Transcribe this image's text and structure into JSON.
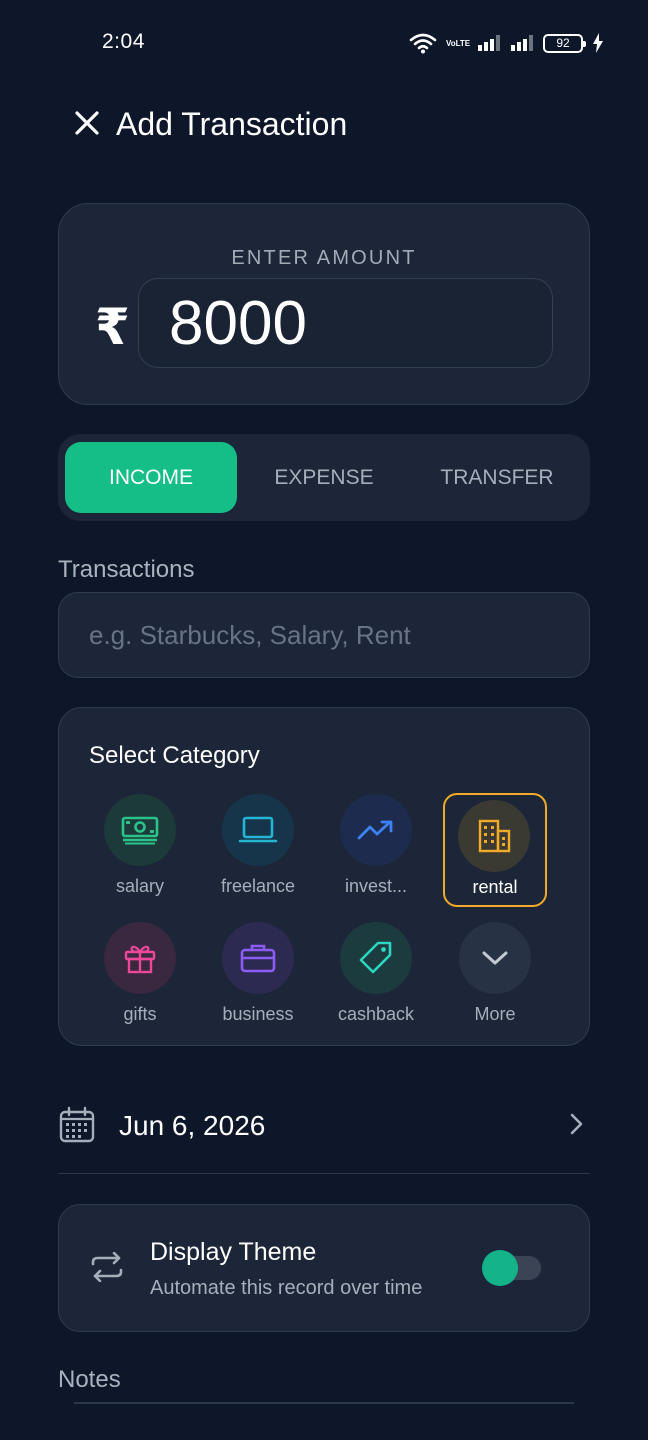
{
  "status_bar": {
    "time": "2:04",
    "network_label": "VoLTE",
    "battery": "92"
  },
  "header": {
    "title": "Add Transaction",
    "close_icon": "close-icon"
  },
  "amount": {
    "label": "ENTER AMOUNT",
    "currency_symbol": "₹",
    "value": "8000"
  },
  "transaction_type": {
    "options": [
      {
        "label": "INCOME",
        "active": true
      },
      {
        "label": "EXPENSE",
        "active": false
      },
      {
        "label": "TRANSFER",
        "active": false
      }
    ]
  },
  "transaction_field": {
    "label": "Transactions",
    "placeholder": "e.g. Starbucks, Salary, Rent",
    "value": ""
  },
  "category": {
    "title": "Select Category",
    "items": [
      {
        "label": "salary",
        "icon": "money-icon",
        "color": "#2bc38a",
        "bg": "#1b3a39"
      },
      {
        "label": "freelance",
        "icon": "laptop-icon",
        "color": "#23b5d3",
        "bg": "#17354a"
      },
      {
        "label": "invest...",
        "icon": "trending-up-icon",
        "color": "#3b82f6",
        "bg": "#1d2c4e"
      },
      {
        "label": "rental",
        "icon": "building-icon",
        "color": "#f1ab27",
        "bg": "#3a3a33",
        "selected": true
      },
      {
        "label": "gifts",
        "icon": "gift-icon",
        "color": "#ec4899",
        "bg": "#3a2740"
      },
      {
        "label": "business",
        "icon": "briefcase-icon",
        "color": "#8b5cf6",
        "bg": "#2d2a52"
      },
      {
        "label": "cashback",
        "icon": "tag-icon",
        "color": "#2dd4bf",
        "bg": "#1c3b3f"
      },
      {
        "label": "More",
        "icon": "chevron-down-icon",
        "color": "#c3c9d3",
        "bg": "#273244"
      }
    ]
  },
  "date": {
    "value": "Jun 6, 2026"
  },
  "recurring": {
    "title": "Display Theme",
    "subtitle": "Automate this record over time",
    "enabled": true
  },
  "notes": {
    "label": "Notes"
  },
  "colors": {
    "background": "#0e1629",
    "card": "#1c2638",
    "accent": "#15be86",
    "selected_border": "#f1ab27"
  }
}
